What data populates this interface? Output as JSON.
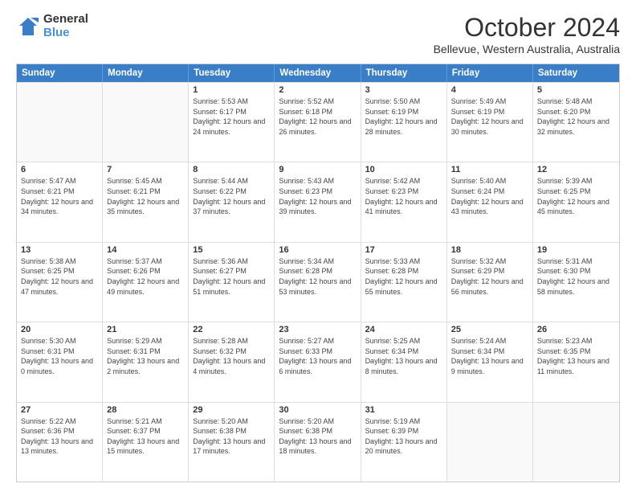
{
  "logo": {
    "general": "General",
    "blue": "Blue"
  },
  "title": "October 2024",
  "subtitle": "Bellevue, Western Australia, Australia",
  "days_of_week": [
    "Sunday",
    "Monday",
    "Tuesday",
    "Wednesday",
    "Thursday",
    "Friday",
    "Saturday"
  ],
  "weeks": [
    [
      {
        "day": "",
        "info": ""
      },
      {
        "day": "",
        "info": ""
      },
      {
        "day": "1",
        "info": "Sunrise: 5:53 AM\nSunset: 6:17 PM\nDaylight: 12 hours and 24 minutes."
      },
      {
        "day": "2",
        "info": "Sunrise: 5:52 AM\nSunset: 6:18 PM\nDaylight: 12 hours and 26 minutes."
      },
      {
        "day": "3",
        "info": "Sunrise: 5:50 AM\nSunset: 6:19 PM\nDaylight: 12 hours and 28 minutes."
      },
      {
        "day": "4",
        "info": "Sunrise: 5:49 AM\nSunset: 6:19 PM\nDaylight: 12 hours and 30 minutes."
      },
      {
        "day": "5",
        "info": "Sunrise: 5:48 AM\nSunset: 6:20 PM\nDaylight: 12 hours and 32 minutes."
      }
    ],
    [
      {
        "day": "6",
        "info": "Sunrise: 5:47 AM\nSunset: 6:21 PM\nDaylight: 12 hours and 34 minutes."
      },
      {
        "day": "7",
        "info": "Sunrise: 5:45 AM\nSunset: 6:21 PM\nDaylight: 12 hours and 35 minutes."
      },
      {
        "day": "8",
        "info": "Sunrise: 5:44 AM\nSunset: 6:22 PM\nDaylight: 12 hours and 37 minutes."
      },
      {
        "day": "9",
        "info": "Sunrise: 5:43 AM\nSunset: 6:23 PM\nDaylight: 12 hours and 39 minutes."
      },
      {
        "day": "10",
        "info": "Sunrise: 5:42 AM\nSunset: 6:23 PM\nDaylight: 12 hours and 41 minutes."
      },
      {
        "day": "11",
        "info": "Sunrise: 5:40 AM\nSunset: 6:24 PM\nDaylight: 12 hours and 43 minutes."
      },
      {
        "day": "12",
        "info": "Sunrise: 5:39 AM\nSunset: 6:25 PM\nDaylight: 12 hours and 45 minutes."
      }
    ],
    [
      {
        "day": "13",
        "info": "Sunrise: 5:38 AM\nSunset: 6:25 PM\nDaylight: 12 hours and 47 minutes."
      },
      {
        "day": "14",
        "info": "Sunrise: 5:37 AM\nSunset: 6:26 PM\nDaylight: 12 hours and 49 minutes."
      },
      {
        "day": "15",
        "info": "Sunrise: 5:36 AM\nSunset: 6:27 PM\nDaylight: 12 hours and 51 minutes."
      },
      {
        "day": "16",
        "info": "Sunrise: 5:34 AM\nSunset: 6:28 PM\nDaylight: 12 hours and 53 minutes."
      },
      {
        "day": "17",
        "info": "Sunrise: 5:33 AM\nSunset: 6:28 PM\nDaylight: 12 hours and 55 minutes."
      },
      {
        "day": "18",
        "info": "Sunrise: 5:32 AM\nSunset: 6:29 PM\nDaylight: 12 hours and 56 minutes."
      },
      {
        "day": "19",
        "info": "Sunrise: 5:31 AM\nSunset: 6:30 PM\nDaylight: 12 hours and 58 minutes."
      }
    ],
    [
      {
        "day": "20",
        "info": "Sunrise: 5:30 AM\nSunset: 6:31 PM\nDaylight: 13 hours and 0 minutes."
      },
      {
        "day": "21",
        "info": "Sunrise: 5:29 AM\nSunset: 6:31 PM\nDaylight: 13 hours and 2 minutes."
      },
      {
        "day": "22",
        "info": "Sunrise: 5:28 AM\nSunset: 6:32 PM\nDaylight: 13 hours and 4 minutes."
      },
      {
        "day": "23",
        "info": "Sunrise: 5:27 AM\nSunset: 6:33 PM\nDaylight: 13 hours and 6 minutes."
      },
      {
        "day": "24",
        "info": "Sunrise: 5:25 AM\nSunset: 6:34 PM\nDaylight: 13 hours and 8 minutes."
      },
      {
        "day": "25",
        "info": "Sunrise: 5:24 AM\nSunset: 6:34 PM\nDaylight: 13 hours and 9 minutes."
      },
      {
        "day": "26",
        "info": "Sunrise: 5:23 AM\nSunset: 6:35 PM\nDaylight: 13 hours and 11 minutes."
      }
    ],
    [
      {
        "day": "27",
        "info": "Sunrise: 5:22 AM\nSunset: 6:36 PM\nDaylight: 13 hours and 13 minutes."
      },
      {
        "day": "28",
        "info": "Sunrise: 5:21 AM\nSunset: 6:37 PM\nDaylight: 13 hours and 15 minutes."
      },
      {
        "day": "29",
        "info": "Sunrise: 5:20 AM\nSunset: 6:38 PM\nDaylight: 13 hours and 17 minutes."
      },
      {
        "day": "30",
        "info": "Sunrise: 5:20 AM\nSunset: 6:38 PM\nDaylight: 13 hours and 18 minutes."
      },
      {
        "day": "31",
        "info": "Sunrise: 5:19 AM\nSunset: 6:39 PM\nDaylight: 13 hours and 20 minutes."
      },
      {
        "day": "",
        "info": ""
      },
      {
        "day": "",
        "info": ""
      }
    ]
  ]
}
